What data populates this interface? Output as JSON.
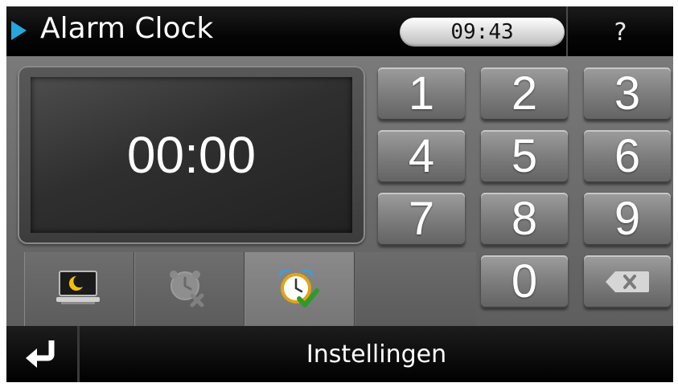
{
  "header": {
    "title": "Alarm Clock",
    "clock": "09:43",
    "help_label": "?"
  },
  "display": {
    "time": "00:00"
  },
  "keypad": {
    "keys": [
      "1",
      "2",
      "3",
      "4",
      "5",
      "6",
      "7",
      "8",
      "9",
      "0"
    ],
    "backspace_icon": "backspace-x-icon"
  },
  "modes": [
    {
      "icon": "sleep-moon-monitor-icon",
      "active": false
    },
    {
      "icon": "alarm-off-icon",
      "active": false
    },
    {
      "icon": "alarm-clock-check-icon",
      "active": true
    }
  ],
  "footer": {
    "back_icon": "return-arrow-icon",
    "label": "Instellingen"
  },
  "colors": {
    "accent_arrow": "#25a6dd",
    "check_green": "#2f9a2a"
  }
}
